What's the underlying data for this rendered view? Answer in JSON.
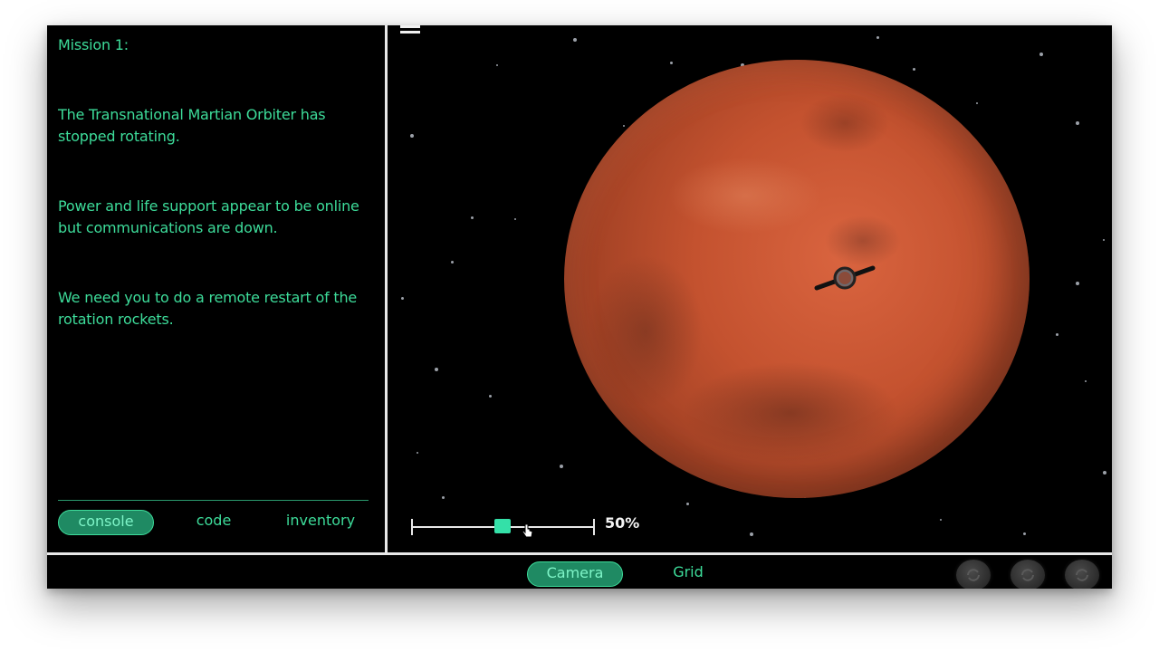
{
  "console": {
    "title": "Mission 1:",
    "paragraphs": [
      "The Transnational Martian Orbiter has stopped rotating.",
      "Power and life support appear to be online but communications are down.",
      "We need you to do a remote restart of the rotation rockets."
    ]
  },
  "panel_tabs": {
    "console": "console",
    "code": "code",
    "inventory": "inventory",
    "active": "console"
  },
  "viewport": {
    "zoom_percent": 50,
    "zoom_label": "50%",
    "planet": "Mars",
    "menu_icon": "hamburger-menu-icon",
    "satellite_icon": "orbiter-icon"
  },
  "view_tabs": {
    "camera": "Camera",
    "grid": "Grid",
    "active": "Camera"
  },
  "colors": {
    "accent": "#3ddc9a",
    "active_tab_bg": "#1f8a63",
    "slider_thumb": "#34e0a8",
    "background": "#000000"
  }
}
